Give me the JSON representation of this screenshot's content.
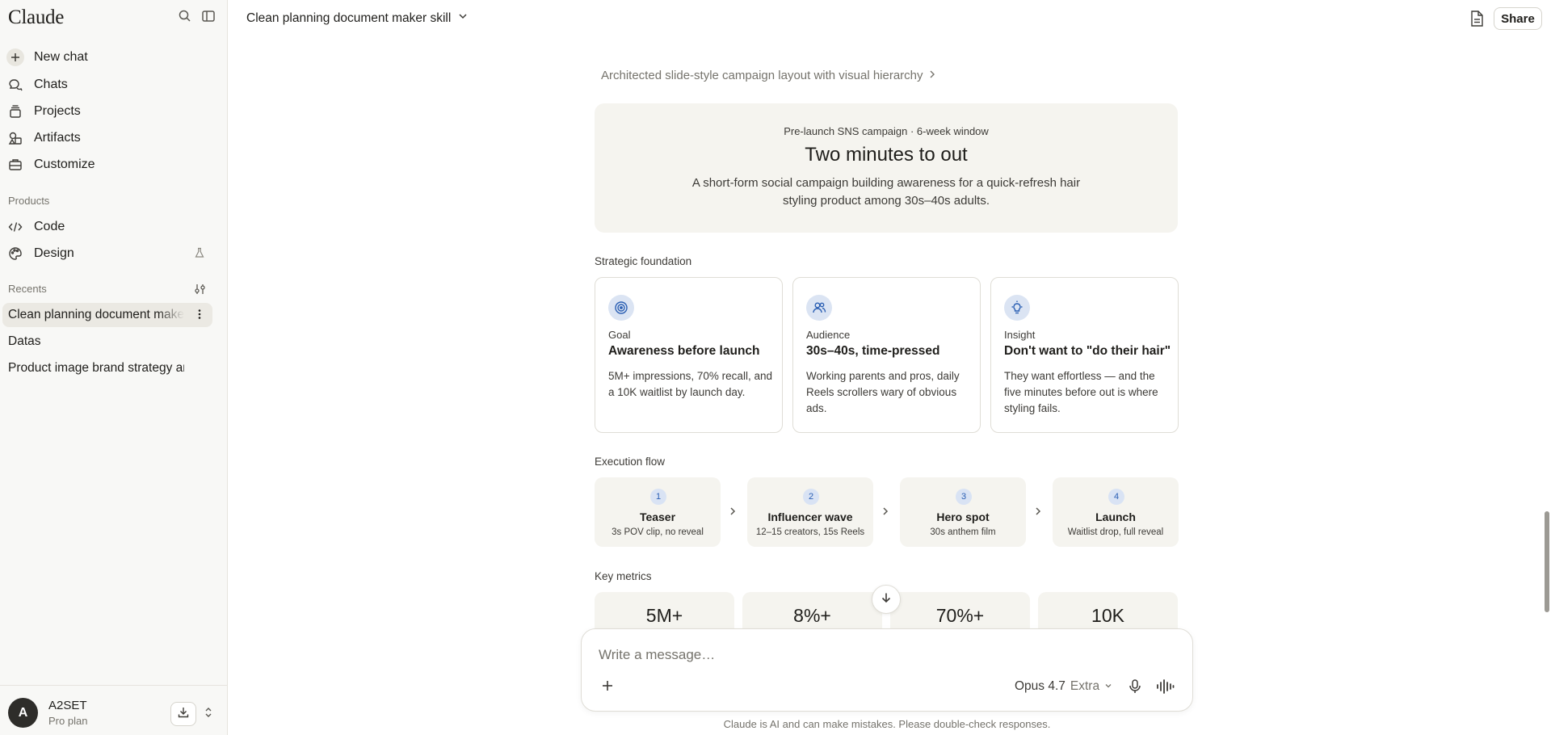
{
  "sidebar": {
    "logo": "Claude",
    "nav": [
      {
        "label": "New chat",
        "icon": "plus-icon"
      },
      {
        "label": "Chats",
        "icon": "chat-bubbles-icon"
      },
      {
        "label": "Projects",
        "icon": "folder-stack-icon"
      },
      {
        "label": "Artifacts",
        "icon": "shapes-icon"
      },
      {
        "label": "Customize",
        "icon": "briefcase-icon"
      }
    ],
    "products_label": "Products",
    "products": [
      {
        "label": "Code",
        "icon": "code-icon"
      },
      {
        "label": "Design",
        "icon": "palette-icon"
      }
    ],
    "recents_label": "Recents",
    "recents": [
      {
        "label": "Clean planning document maker skill",
        "active": true
      },
      {
        "label": "Datas"
      },
      {
        "label": "Product image brand strategy an…"
      }
    ],
    "user": {
      "initial": "A",
      "name": "A2SET",
      "plan": "Pro plan"
    }
  },
  "header": {
    "title": "Clean planning document maker skill",
    "share_label": "Share"
  },
  "content": {
    "thinking": "Architected slide-style campaign layout with visual hierarchy",
    "hero": {
      "kicker": "Pre-launch SNS campaign · 6-week window",
      "title": "Two minutes to out",
      "description": "A short-form social campaign building awareness for a quick-refresh hair styling product among 30s–40s adults."
    },
    "strategic_label": "Strategic foundation",
    "cards": [
      {
        "category": "Goal",
        "title": "Awareness before launch",
        "desc": "5M+ impressions, 70% recall, and a 10K waitlist by launch day.",
        "icon": "target-icon"
      },
      {
        "category": "Audience",
        "title": "30s–40s, time-pressed",
        "desc": "Working parents and pros, daily Reels scrollers wary of obvious ads.",
        "icon": "people-icon"
      },
      {
        "category": "Insight",
        "title": "Don't want to \"do their hair\"",
        "desc": "They want effortless — and the five minutes before out is where styling fails.",
        "icon": "lightbulb-icon"
      }
    ],
    "execution_label": "Execution flow",
    "steps": [
      {
        "num": "1",
        "title": "Teaser",
        "sub": "3s POV clip, no reveal"
      },
      {
        "num": "2",
        "title": "Influencer wave",
        "sub": "12–15 creators, 15s Reels"
      },
      {
        "num": "3",
        "title": "Hero spot",
        "sub": "30s anthem film"
      },
      {
        "num": "4",
        "title": "Launch",
        "sub": "Waitlist drop, full reveal"
      }
    ],
    "metrics_label": "Key metrics",
    "metrics": [
      "5M+",
      "8%+",
      "70%+",
      "10K"
    ]
  },
  "composer": {
    "placeholder": "Write a message…",
    "model": "Opus 4.7",
    "effort": "Extra",
    "disclaimer": "Claude is AI and can make mistakes. Please double-check responses."
  },
  "colors": {
    "sidebar_bg": "#f8f8f6",
    "card_fill": "#f5f4ef",
    "accent_blue": "#2b5fb3"
  }
}
